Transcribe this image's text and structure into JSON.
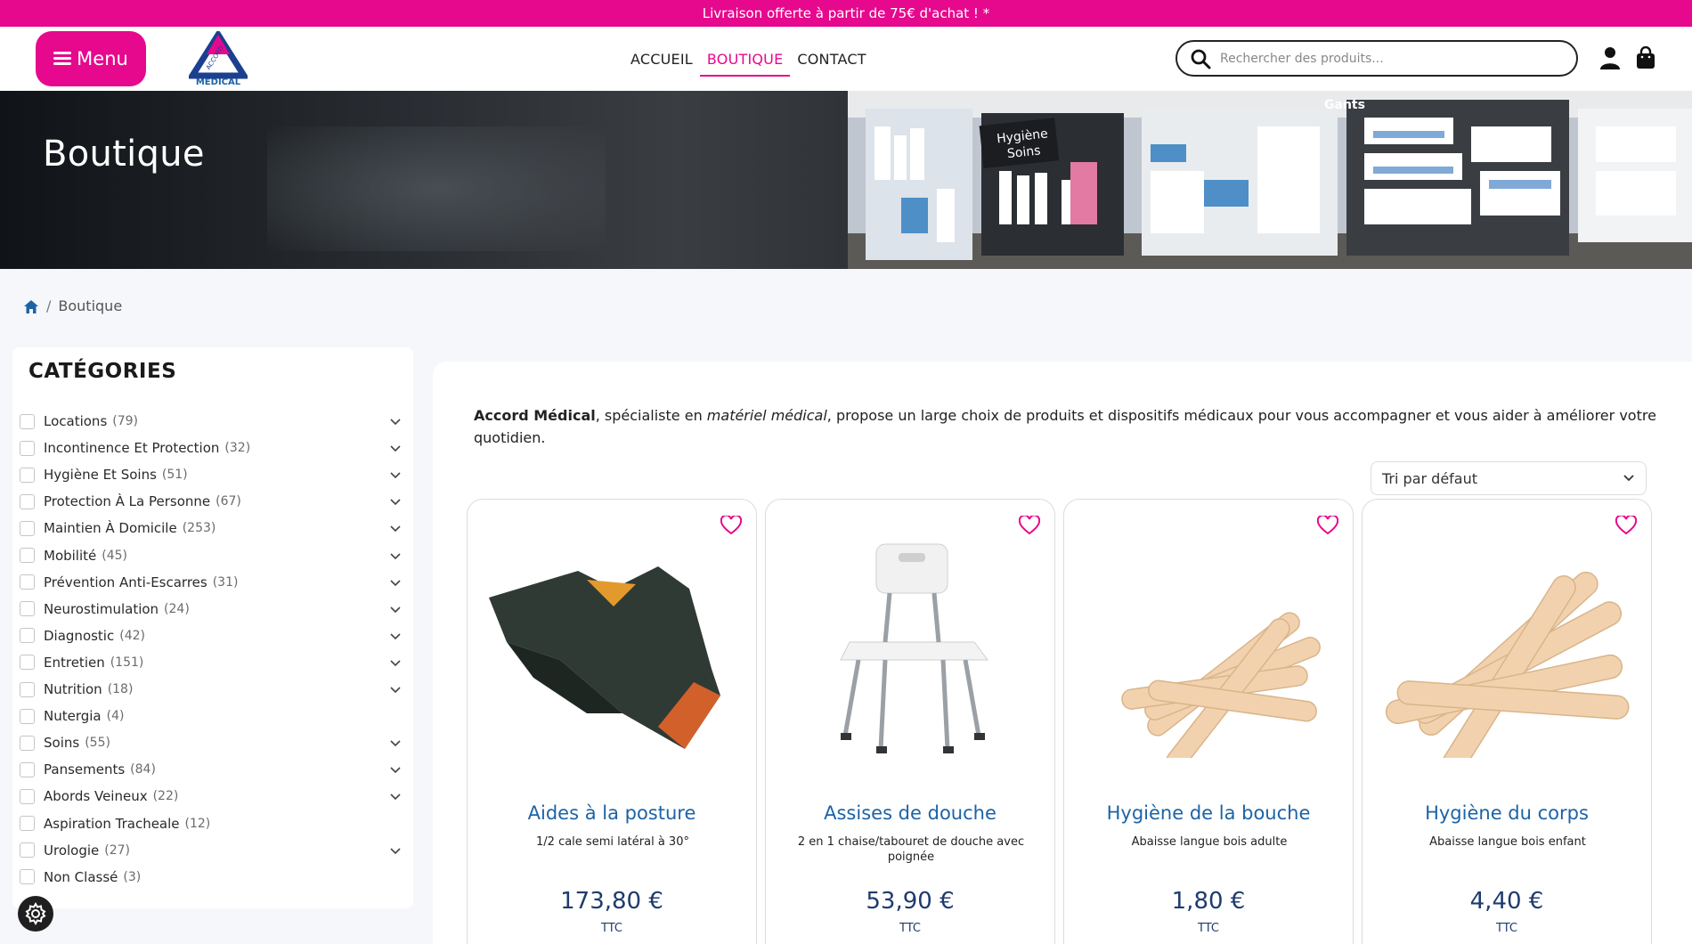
{
  "promo": {
    "text": "Livraison offerte à partir de 75€ d'achat ! *"
  },
  "header": {
    "menu_label": "Menu",
    "logo_text_top": "ACCORD",
    "logo_text_bottom": "MEDICAL",
    "nav": [
      {
        "label": "ACCUEIL",
        "active": false
      },
      {
        "label": "BOUTIQUE",
        "active": true
      },
      {
        "label": "CONTACT",
        "active": false
      }
    ],
    "search_placeholder": "Rechercher des produits...",
    "icons": [
      "search-icon",
      "user-icon",
      "shopping-bag-icon"
    ]
  },
  "hero": {
    "title": "Boutique",
    "sign_1": "Hygiène",
    "sign_2": "Soins",
    "sign_3": "Gants"
  },
  "breadcrumb": {
    "home_icon": "home-icon",
    "current": "Boutique"
  },
  "sidebar": {
    "title": "CATÉGORIES",
    "categories": [
      {
        "label": "Locations",
        "count": "(79)",
        "expandable": true
      },
      {
        "label": "Incontinence Et Protection",
        "count": "(32)",
        "expandable": true
      },
      {
        "label": "Hygiène Et Soins",
        "count": "(51)",
        "expandable": true
      },
      {
        "label": "Protection À La Personne",
        "count": "(67)",
        "expandable": true
      },
      {
        "label": "Maintien À Domicile",
        "count": "(253)",
        "expandable": true
      },
      {
        "label": "Mobilité",
        "count": "(45)",
        "expandable": true
      },
      {
        "label": "Prévention Anti-Escarres",
        "count": "(31)",
        "expandable": true
      },
      {
        "label": "Neurostimulation",
        "count": "(24)",
        "expandable": true
      },
      {
        "label": "Diagnostic",
        "count": "(42)",
        "expandable": true
      },
      {
        "label": "Entretien",
        "count": "(151)",
        "expandable": true
      },
      {
        "label": "Nutrition",
        "count": "(18)",
        "expandable": true
      },
      {
        "label": "Nutergia",
        "count": "(4)",
        "expandable": false
      },
      {
        "label": "Soins",
        "count": "(55)",
        "expandable": true
      },
      {
        "label": "Pansements",
        "count": "(84)",
        "expandable": true
      },
      {
        "label": "Abords Veineux",
        "count": "(22)",
        "expandable": true
      },
      {
        "label": "Aspiration Tracheale",
        "count": "(12)",
        "expandable": false
      },
      {
        "label": "Urologie",
        "count": "(27)",
        "expandable": true
      },
      {
        "label": "Non Classé",
        "count": "(3)",
        "expandable": false
      }
    ]
  },
  "main": {
    "intro_brand": "Accord Médical",
    "intro_part1": ", spécialiste en ",
    "intro_em": "matériel médical",
    "intro_part2": ", propose un large choix de produits et dispositifs médicaux pour vous accompagner et vous aider à améliorer votre quotidien.",
    "sort_label": "Tri par défaut",
    "products": [
      {
        "name": "Aides à la posture",
        "desc": "1/2 cale semi latéral à 30°",
        "price": "173,80 €",
        "ttc": "TTC"
      },
      {
        "name": "Assises de douche",
        "desc": "2 en 1 chaise/tabouret de douche avec poignée",
        "price": "53,90 €",
        "ttc": "TTC"
      },
      {
        "name": "Hygiène de la bouche",
        "desc": "Abaisse langue bois adulte",
        "price": "1,80 €",
        "ttc": "TTC"
      },
      {
        "name": "Hygiène du corps",
        "desc": "Abaisse langue bois enfant",
        "price": "4,40 €",
        "ttc": "TTC"
      }
    ]
  },
  "colors": {
    "brand_pink": "#e6088d",
    "link_blue": "#1c63a6",
    "price_navy": "#1f3b6e"
  }
}
